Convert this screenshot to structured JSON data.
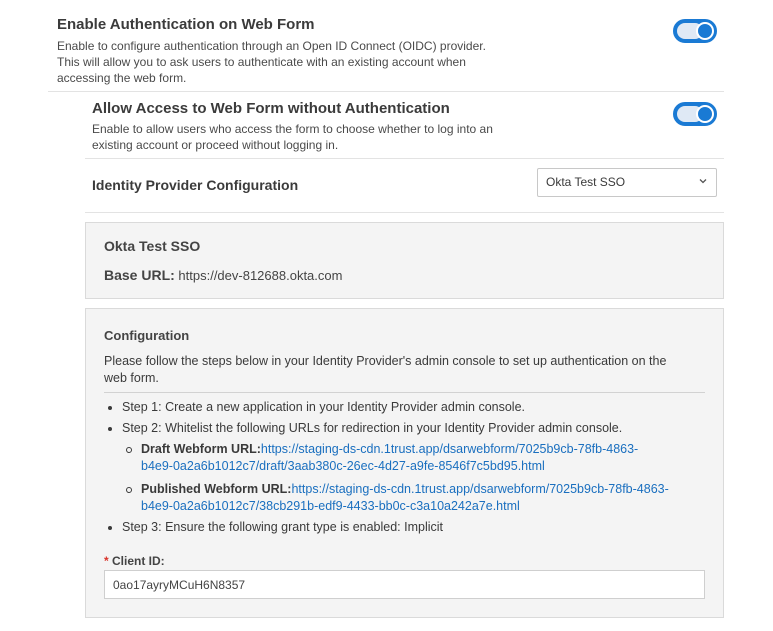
{
  "auth": {
    "title": "Enable Authentication on Web Form",
    "description_lines": [
      "Enable to configure authentication through an Open ID Connect (OIDC) provider.",
      "This will allow you to ask users to authenticate with an existing account when",
      "accessing the web form."
    ],
    "enabled": true
  },
  "access": {
    "title": "Allow Access to Web Form without Authentication",
    "description_lines": [
      "Enable to allow users who access the form to choose whether to log into an",
      "existing account or proceed without logging in."
    ],
    "enabled": true
  },
  "idp": {
    "label": "Identity Provider Configuration",
    "selected": "Okta Test SSO"
  },
  "provider_card": {
    "name": "Okta Test SSO",
    "base_url_label": "Base URL:",
    "base_url_value": " https://dev-812688.okta.com"
  },
  "configuration": {
    "heading": "Configuration",
    "intro_lines": [
      "Please follow the steps below in your Identity Provider's admin console to set up authentication on the",
      "web form."
    ],
    "step1": "Step 1: Create a new application in your Identity Provider admin console.",
    "step2": "Step 2: Whitelist the following URLs for redirection in your Identity Provider admin console.",
    "draft_label": "Draft Webform URL:",
    "draft_url_lines": [
      "https://staging-ds-cdn.1trust.app/dsarwebform/7025b9cb-78fb-4863-",
      "b4e9-0a2a6b1012c7/draft/3aab380c-26ec-4d27-a9fe-8546f7c5bd95.html"
    ],
    "published_label": "Published Webform URL:",
    "published_url_lines": [
      "https://staging-ds-cdn.1trust.app/dsarwebform/7025b9cb-78fb-4863-",
      "b4e9-0a2a6b1012c7/38cb291b-edf9-4433-bb0c-c3a10a242a7e.html"
    ],
    "step3": "Step 3: Ensure the following grant type is enabled: Implicit"
  },
  "client_id": {
    "required_mark": "*",
    "label": " Client ID:",
    "value": "0ao17ayryMCuH6N8357"
  },
  "colors": {
    "accent": "#1a7ad4",
    "link": "#1a6fbf",
    "required": "#d9342b"
  }
}
